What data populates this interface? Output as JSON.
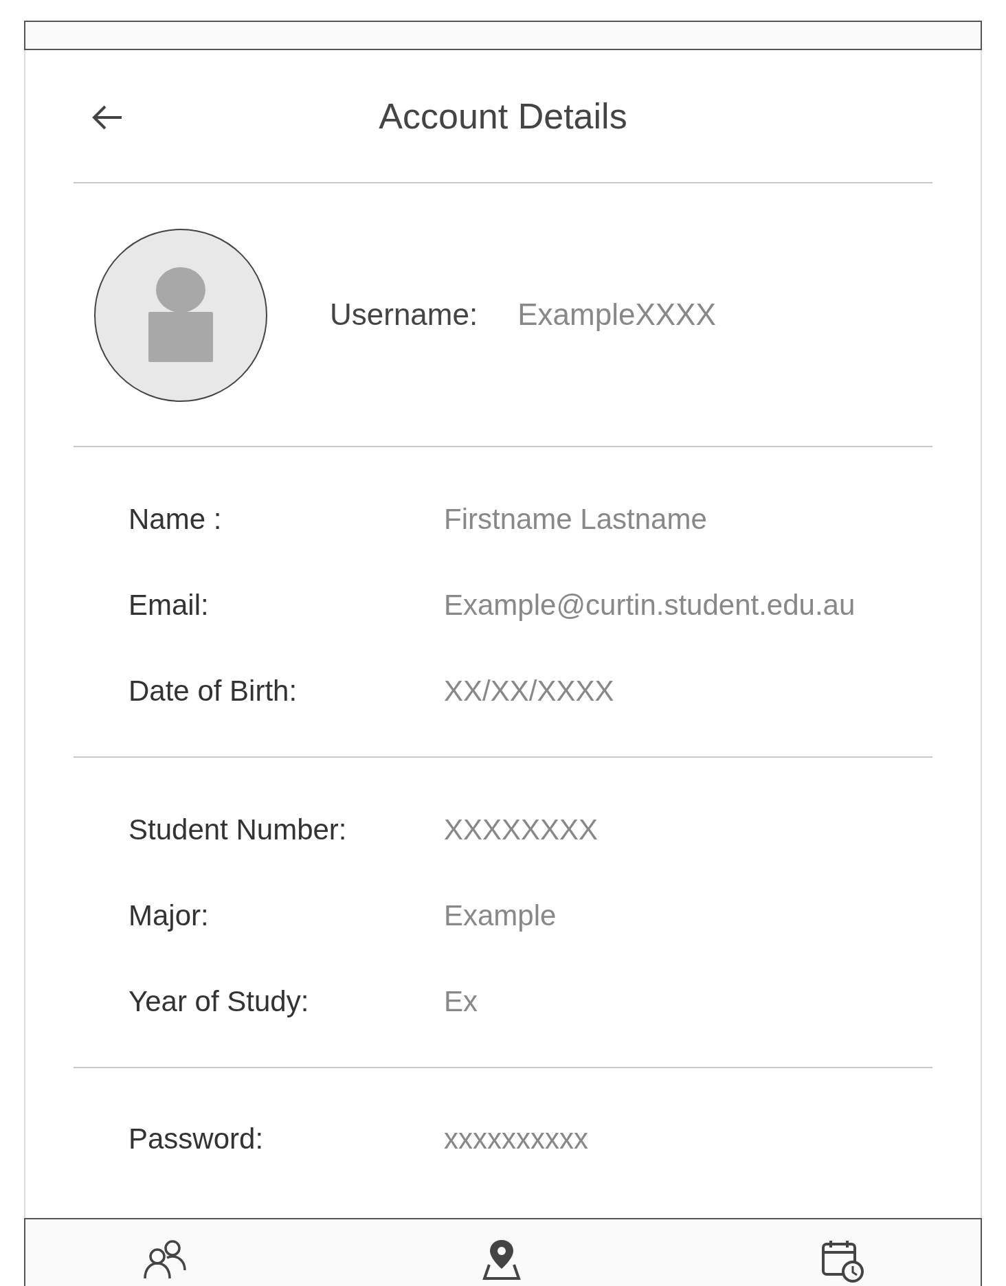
{
  "header": {
    "title": "Account Details"
  },
  "profile": {
    "label": "Username:",
    "value": "ExampleXXXX"
  },
  "sections": [
    {
      "fields": [
        {
          "label": "Name :",
          "value": "Firstname Lastname"
        },
        {
          "label": "Email:",
          "value": "Example@curtin.student.edu.au"
        },
        {
          "label": "Date of Birth:",
          "value": "XX/XX/XXXX"
        }
      ]
    },
    {
      "fields": [
        {
          "label": "Student Number:",
          "value": "XXXXXXXX"
        },
        {
          "label": "Major:",
          "value": "Example"
        },
        {
          "label": "Year of Study:",
          "value": "Ex"
        }
      ]
    },
    {
      "fields": [
        {
          "label": "Password:",
          "value": "xxxxxxxxxx"
        }
      ]
    }
  ]
}
